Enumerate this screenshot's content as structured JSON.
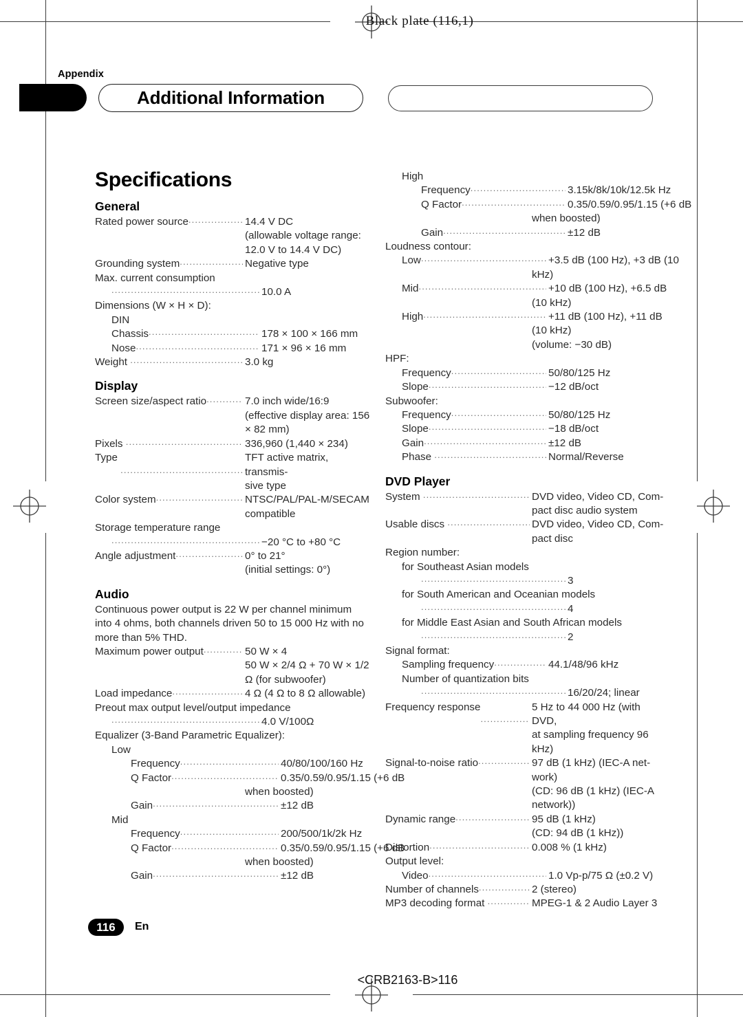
{
  "print_marks": {
    "black_plate": "Black plate (116,1)",
    "footer_code": "<CRB2163-B>116"
  },
  "header": {
    "appendix_label": "Appendix",
    "chapter_title": "Additional Information"
  },
  "page_footer": {
    "page_number": "116",
    "language": "En"
  },
  "main": {
    "page_title": "Specifications",
    "left_column": [
      {
        "type": "heading",
        "text": "General"
      },
      {
        "type": "row",
        "label": "Rated power source",
        "value": "14.4 V DC"
      },
      {
        "type": "cont",
        "text": "(allowable voltage range:"
      },
      {
        "type": "cont",
        "text": "12.0 V to 14.4 V DC)"
      },
      {
        "type": "row",
        "label": "Grounding system",
        "value": "Negative type"
      },
      {
        "type": "plain",
        "text": "Max. current consumption"
      },
      {
        "type": "leaderrow",
        "indent": 1,
        "value": "10.0 A"
      },
      {
        "type": "plain",
        "text": "Dimensions (W × H × D):"
      },
      {
        "type": "plain",
        "indent": 1,
        "text": "DIN"
      },
      {
        "type": "row",
        "indent": 1,
        "label": "Chassis",
        "value": "178 × 100 × 166 mm"
      },
      {
        "type": "row",
        "indent": 1,
        "label": "Nose",
        "value": "171 × 96 × 16 mm"
      },
      {
        "type": "row",
        "label": "Weight ",
        "value": "3.0 kg"
      },
      {
        "type": "heading",
        "text": "Display"
      },
      {
        "type": "row",
        "label": "Screen size/aspect ratio",
        "value": "7.0 inch wide/16:9"
      },
      {
        "type": "cont",
        "text": "(effective display area: 156"
      },
      {
        "type": "cont",
        "text": "× 82 mm)"
      },
      {
        "type": "row",
        "label": "Pixels ",
        "value": "336,960 (1,440 × 234)"
      },
      {
        "type": "row",
        "label": "Type ",
        "value": "TFT active matrix, transmis-"
      },
      {
        "type": "cont",
        "text": "sive type"
      },
      {
        "type": "row",
        "label": "Color system",
        "value": "NTSC/PAL/PAL-M/SECAM"
      },
      {
        "type": "cont",
        "text": "compatible"
      },
      {
        "type": "plain",
        "text": "Storage temperature range"
      },
      {
        "type": "leaderrow",
        "indent": 1,
        "value": "−20 °C to +80 °C"
      },
      {
        "type": "row",
        "label": "Angle adjustment",
        "value": "0° to 21°"
      },
      {
        "type": "cont",
        "text": "(initial settings: 0°)"
      },
      {
        "type": "heading",
        "text": "Audio"
      },
      {
        "type": "plain",
        "text": "Continuous power output is 22 W per channel minimum into 4 ohms, both channels driven 50 to 15 000 Hz with no more than 5% THD."
      },
      {
        "type": "row",
        "label": "Maximum power output",
        "value": "50 W × 4"
      },
      {
        "type": "cont",
        "text": "50 W × 2/4 Ω + 70 W × 1/2"
      },
      {
        "type": "cont",
        "text": "Ω (for subwoofer)"
      },
      {
        "type": "row",
        "label": "Load impedance",
        "value": "4 Ω (4 Ω to 8 Ω allowable)"
      },
      {
        "type": "plain",
        "text": "Preout max output level/output impedance"
      },
      {
        "type": "leaderrow",
        "indent": 1,
        "value": "4.0 V/100Ω"
      },
      {
        "type": "plain",
        "text": "Equalizer (3-Band Parametric Equalizer):"
      },
      {
        "type": "plain",
        "indent": 1,
        "text": "Low"
      },
      {
        "type": "row",
        "indent": 2,
        "label": "Frequency",
        "value": "40/80/100/160 Hz"
      },
      {
        "type": "row",
        "indent": 2,
        "label": "Q Factor",
        "value": "0.35/0.59/0.95/1.15 (+6 dB"
      },
      {
        "type": "cont",
        "text": "when boosted)"
      },
      {
        "type": "row",
        "indent": 2,
        "label": "Gain",
        "value": "±12 dB"
      },
      {
        "type": "plain",
        "indent": 1,
        "text": "Mid"
      },
      {
        "type": "row",
        "indent": 2,
        "label": "Frequency",
        "value": "200/500/1k/2k Hz"
      },
      {
        "type": "row",
        "indent": 2,
        "label": "Q Factor",
        "value": "0.35/0.59/0.95/1.15 (+6 dB"
      },
      {
        "type": "cont",
        "text": "when boosted)"
      },
      {
        "type": "row",
        "indent": 2,
        "label": "Gain",
        "value": "±12 dB"
      }
    ],
    "right_column": [
      {
        "type": "plain",
        "indent": 1,
        "text": "High"
      },
      {
        "type": "row",
        "indent": 2,
        "label": "Frequency",
        "value": "3.15k/8k/10k/12.5k Hz"
      },
      {
        "type": "row",
        "indent": 2,
        "label": "Q Factor",
        "value": "0.35/0.59/0.95/1.15 (+6 dB"
      },
      {
        "type": "cont",
        "text": "when boosted)"
      },
      {
        "type": "row",
        "indent": 2,
        "label": "Gain",
        "value": "±12 dB"
      },
      {
        "type": "plain",
        "text": "Loudness contour:"
      },
      {
        "type": "row",
        "indent": 1,
        "label": "Low",
        "value": "+3.5 dB (100 Hz), +3 dB (10"
      },
      {
        "type": "cont",
        "text": "kHz)"
      },
      {
        "type": "row",
        "indent": 1,
        "label": "Mid",
        "value": "+10 dB (100 Hz), +6.5 dB"
      },
      {
        "type": "cont",
        "text": "(10 kHz)"
      },
      {
        "type": "row",
        "indent": 1,
        "label": "High",
        "value": "+11 dB (100 Hz), +11 dB"
      },
      {
        "type": "cont",
        "text": "(10 kHz)"
      },
      {
        "type": "cont",
        "text": "(volume: −30 dB)"
      },
      {
        "type": "plain",
        "text": "HPF:"
      },
      {
        "type": "row",
        "indent": 1,
        "label": "Frequency",
        "value": "50/80/125 Hz"
      },
      {
        "type": "row",
        "indent": 1,
        "label": "Slope",
        "value": "−12 dB/oct"
      },
      {
        "type": "plain",
        "text": "Subwoofer:"
      },
      {
        "type": "row",
        "indent": 1,
        "label": "Frequency",
        "value": "50/80/125 Hz"
      },
      {
        "type": "row",
        "indent": 1,
        "label": "Slope",
        "value": "−18 dB/oct"
      },
      {
        "type": "row",
        "indent": 1,
        "label": "Gain",
        "value": "±12 dB"
      },
      {
        "type": "row",
        "indent": 1,
        "label": "Phase ",
        "value": "Normal/Reverse"
      },
      {
        "type": "heading",
        "text": "DVD Player"
      },
      {
        "type": "row",
        "label": "System ",
        "value": "DVD video, Video CD, Com-"
      },
      {
        "type": "cont",
        "text": "pact disc audio system"
      },
      {
        "type": "row",
        "label": "Usable discs ",
        "value": "DVD video, Video CD, Com-"
      },
      {
        "type": "cont",
        "text": "pact disc"
      },
      {
        "type": "plain",
        "text": "Region number:"
      },
      {
        "type": "plain",
        "indent": 1,
        "text": "for Southeast Asian models"
      },
      {
        "type": "leaderrow",
        "indent": 2,
        "value": "3"
      },
      {
        "type": "plain",
        "indent": 1,
        "text": "for South American and Oceanian models"
      },
      {
        "type": "leaderrow",
        "indent": 2,
        "value": "4"
      },
      {
        "type": "plain",
        "indent": 1,
        "text": "for Middle East Asian and South African models"
      },
      {
        "type": "leaderrow",
        "indent": 2,
        "value": "2"
      },
      {
        "type": "plain",
        "text": "Signal format:"
      },
      {
        "type": "row",
        "indent": 1,
        "label": "Sampling frequency",
        "value": "44.1/48/96 kHz"
      },
      {
        "type": "plain",
        "indent": 1,
        "text": "Number of quantization bits"
      },
      {
        "type": "leaderrow",
        "indent": 2,
        "value": "16/20/24; linear"
      },
      {
        "type": "row",
        "label": "Frequency response",
        "value": "5 Hz to 44 000 Hz (with DVD,"
      },
      {
        "type": "cont",
        "text": "at sampling frequency 96"
      },
      {
        "type": "cont",
        "text": "kHz)"
      },
      {
        "type": "row",
        "label": "Signal-to-noise ratio",
        "value": "97 dB (1 kHz) (IEC-A net-"
      },
      {
        "type": "cont",
        "text": "work)"
      },
      {
        "type": "cont",
        "text": "(CD: 96 dB (1 kHz) (IEC-A"
      },
      {
        "type": "cont",
        "text": "network))"
      },
      {
        "type": "row",
        "label": "Dynamic range",
        "value": "95 dB (1 kHz)"
      },
      {
        "type": "cont",
        "text": "(CD: 94 dB (1 kHz))"
      },
      {
        "type": "row",
        "label": "Distortion",
        "value": "0.008 % (1 kHz)"
      },
      {
        "type": "plain",
        "text": "Output level:"
      },
      {
        "type": "row",
        "indent": 1,
        "label": "Video",
        "value": "1.0 Vp-p/75 Ω (±0.2 V)"
      },
      {
        "type": "row",
        "label": "Number of channels",
        "value": "2 (stereo)"
      },
      {
        "type": "row",
        "label": "MP3 decoding format ",
        "value": "MPEG-1 & 2 Audio Layer 3"
      }
    ]
  }
}
